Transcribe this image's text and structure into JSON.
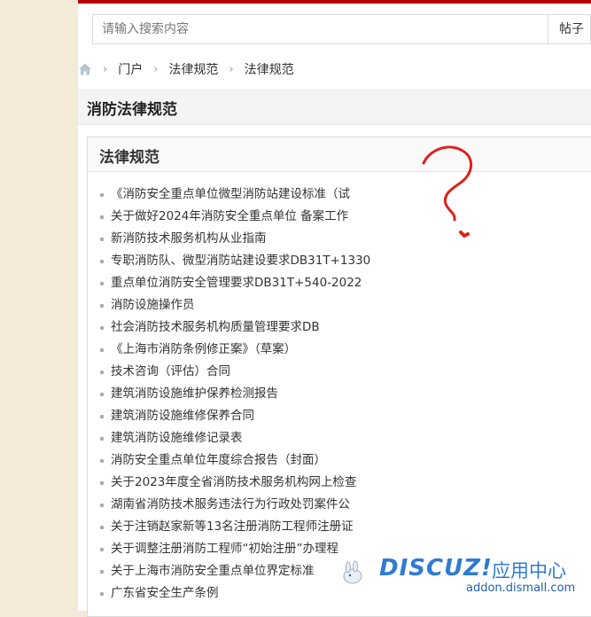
{
  "search": {
    "placeholder": "请输入搜索内容",
    "type_label": "帖子"
  },
  "breadcrumb": {
    "items": [
      "门户",
      "法律规范",
      "法律规范"
    ]
  },
  "section": {
    "title": "消防法律规范"
  },
  "box": {
    "title": "法律规范"
  },
  "articles": [
    "《消防安全重点单位微型消防站建设标准（试",
    "关于做好2024年消防安全重点单位 备案工作",
    "新消防技术服务机构从业指南",
    "专职消防队、微型消防站建设要求DB31T+1330",
    "重点单位消防安全管理要求DB31T+540-2022",
    "消防设施操作员",
    "社会消防技术服务机构质量管理要求DB",
    "《上海市消防条例修正案》（草案）",
    "技术咨询（评估）合同",
    "建筑消防设施维护保养检测报告",
    "建筑消防设施维修保养合同",
    "建筑消防设施维修记录表",
    "消防安全重点单位年度综合报告（封面）",
    "关于2023年度全省消防技术服务机构网上检查",
    "湖南省消防技术服务违法行为行政处罚案件公",
    "关于注销赵家新等13名注册消防工程师注册证",
    "关于调整注册消防工程师“初始注册”办理程",
    "关于上海市消防安全重点单位界定标准",
    "广东省安全生产条例"
  ],
  "watermark": {
    "brand": "DISCUZ!",
    "label": "应用中心",
    "url": "addon.dismall.com"
  },
  "colors": {
    "accent": "#b50000",
    "brand": "#2f7bd4",
    "annotation": "#e0201a"
  }
}
